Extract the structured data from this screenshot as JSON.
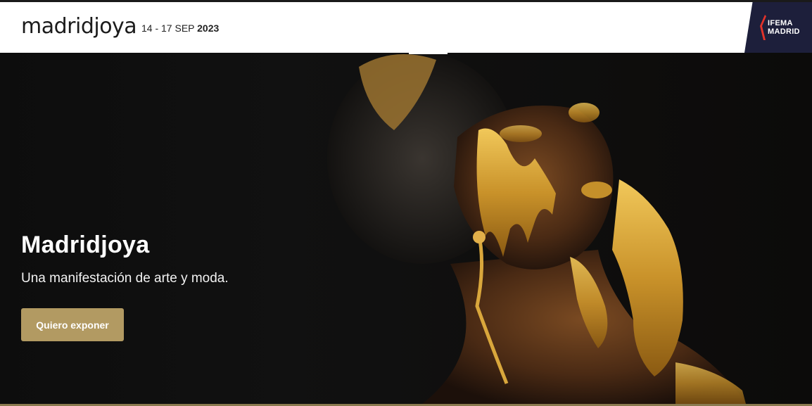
{
  "header": {
    "logo_text": "madridjoya",
    "dates_prefix": "14 - 17 SEP",
    "dates_year": "2023",
    "partner_line1": "IFEMA",
    "partner_line2": "MADRID"
  },
  "hero": {
    "title": "Madridjoya",
    "subtitle": "Una manifestación de arte y moda.",
    "cta_label": "Quiero exponer",
    "image_subject": "woman with gold paint on face and hands"
  },
  "colors": {
    "accent_gold": "#b29a62",
    "partner_navy": "#1d1f3b",
    "partner_red": "#e4332a"
  }
}
